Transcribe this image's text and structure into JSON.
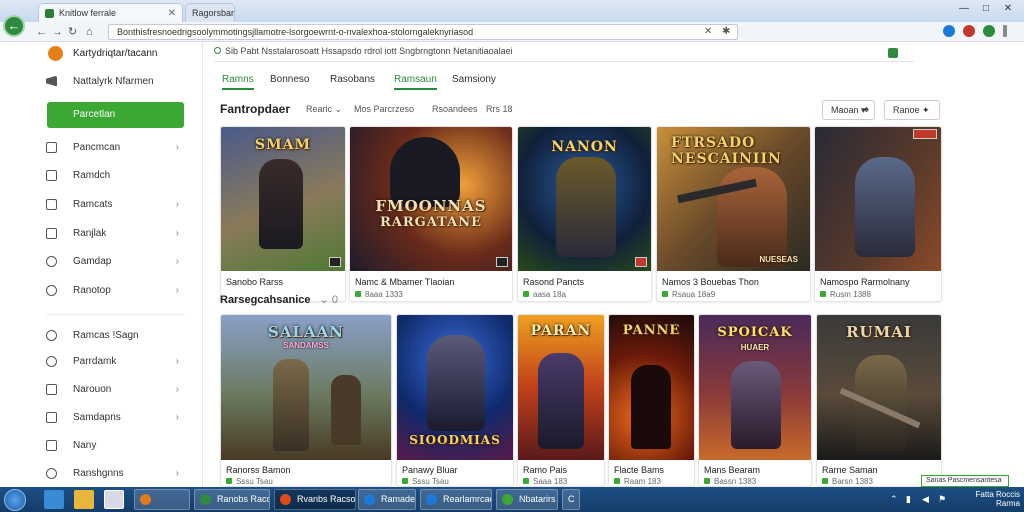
{
  "browser": {
    "tabs": [
      {
        "label": "Knitlow ferrale"
      },
      {
        "label": "Ragorsbar"
      }
    ],
    "url": "Bonthisfresnoedrigsoolymmotingsjllamotre-lsorgoewrnt-o-nvalexhoa-stolorngaleknyriasod",
    "window_controls": [
      "—",
      "□",
      "✕"
    ]
  },
  "sidebar": {
    "brand": "Kartydriqtar/tacann",
    "first_item": "Nattalyrk Nfarmen",
    "active_item": "Parcetlan",
    "items": [
      {
        "label": "Pancmcan",
        "chevron": true
      },
      {
        "label": "Ramdch",
        "chevron": false
      },
      {
        "label": "Ramcats",
        "chevron": true
      },
      {
        "label": "Ranjlak",
        "chevron": true
      },
      {
        "label": "Gamdap",
        "chevron": true
      },
      {
        "label": "Ranotop",
        "chevron": true
      }
    ],
    "items2": [
      {
        "label": "Ramcas !Sagn",
        "chevron": false
      },
      {
        "label": "Parrdamk",
        "chevron": true
      },
      {
        "label": "Narouon",
        "chevron": true
      },
      {
        "label": "Samdapns",
        "chevron": true
      },
      {
        "label": "Nany",
        "chevron": false
      },
      {
        "label": "Ranshgnns",
        "chevron": true
      }
    ]
  },
  "main": {
    "search_text": "Sib  Pabt Nsstalarosoatt Hssapsdo rdrol  iott Sngbrngtonn Netanitiaoalaei",
    "tabs": [
      {
        "label": "Ramns",
        "active": true
      },
      {
        "label": "Bonneso",
        "active": false
      },
      {
        "label": "Rasobans",
        "active": false
      },
      {
        "label": "Ramsaun",
        "active": true
      },
      {
        "label": "Samsiony",
        "active": false
      }
    ],
    "page_title": "Fantropdaer",
    "filters": [
      "Rearic ⌄",
      "Mos  Parcrzeso",
      "Rsoandees",
      "Rrs 18"
    ],
    "controls": [
      {
        "label": "Maoan",
        "icon": "▾"
      },
      {
        "label": "♠",
        "icon": ""
      },
      {
        "label": "Ranoe",
        "icon": "✦"
      }
    ],
    "row1_cards": [
      {
        "art_title": "SMAM",
        "art_sub": "",
        "name": "Sanobo  Rarss",
        "meta": "",
        "color_a": "#4a5a8a",
        "color_b": "#7c9b5a"
      },
      {
        "art_title": "FMOONNAS",
        "art_sub": "RARGATANE",
        "name": "Namc & Mbamer Tlaoian",
        "meta": "8aaa  1333",
        "color_a": "#2e2a3a",
        "color_b": "#d8782a"
      },
      {
        "art_title": "NANON",
        "art_sub": "",
        "name": "Rasond Pancts",
        "meta": "aasa  18a",
        "color_a": "#16305a",
        "color_b": "#3a7a2a"
      },
      {
        "art_title": "FTRSADO  NESCAINIIN",
        "art_sub": "NUESEAS",
        "name": "Namos 3 Bouebas Thon",
        "meta": "Rsaua  18a9",
        "color_a": "#3a2a20",
        "color_b": "#c8903a"
      },
      {
        "art_title": "",
        "art_sub": "",
        "name": "Namospo Rarmolnany",
        "meta": "Rusm  1388",
        "color_a": "#2a2a36",
        "color_b": "#8a4a2a"
      }
    ],
    "section_title": "Rarsegcahsanice",
    "row2_cards": [
      {
        "art_title": "SALAAN",
        "art_sub": "SANDAMSS",
        "name": "Ranorss Bamon",
        "meta": "Sssu  Tsau",
        "color_a": "#6a7aa0",
        "color_b": "#6a5a3a"
      },
      {
        "art_title": "",
        "art_sub": "SIOODMIAS",
        "name": "Panawy Bluar",
        "meta": "Sssu  Tsau",
        "color_a": "#0e2a6a",
        "color_b": "#7a2a5a"
      },
      {
        "art_title": "PARAN",
        "art_sub": "",
        "name": "Ramo Pais",
        "meta": "Saaa  183",
        "color_a": "#a02a1a",
        "color_b": "#f0a020"
      },
      {
        "art_title": "PANNE",
        "art_sub": "",
        "name": "Flacte Bams",
        "meta": "Raam  183",
        "color_a": "#1a0a0a",
        "color_b": "#d83a0a"
      },
      {
        "art_title": "SPOICAK",
        "art_sub": "HUAER",
        "name": "Mans Bearam",
        "meta": "Bassn  1383",
        "color_a": "#3a1a4a",
        "color_b": "#c86a2a"
      },
      {
        "art_title": "RUMAI",
        "art_sub": "",
        "name": "Rarne Saman",
        "meta": "Barsn  1383",
        "color_a": "#1a1a1a",
        "color_b": "#7a6a4a"
      }
    ],
    "notification": "Sanas Pascmensantesa"
  },
  "taskbar": {
    "buttons": [
      {
        "label": "",
        "color": "#e07a1a"
      },
      {
        "label": "Ranobs Racos",
        "color": "#2e8b3e"
      },
      {
        "label": "Rvanbs Racsons",
        "color": "#e04a1a"
      },
      {
        "label": "Ramadea",
        "color": "#1b7ad8"
      },
      {
        "label": "Rearlamrcaes",
        "color": "#1b7ad8"
      },
      {
        "label": "Nbatarirs",
        "color": "#3aa832"
      },
      {
        "label": "C",
        "color": "#888888"
      }
    ],
    "clock_time": "Fatta Roccis",
    "clock_date": "Rarma"
  }
}
